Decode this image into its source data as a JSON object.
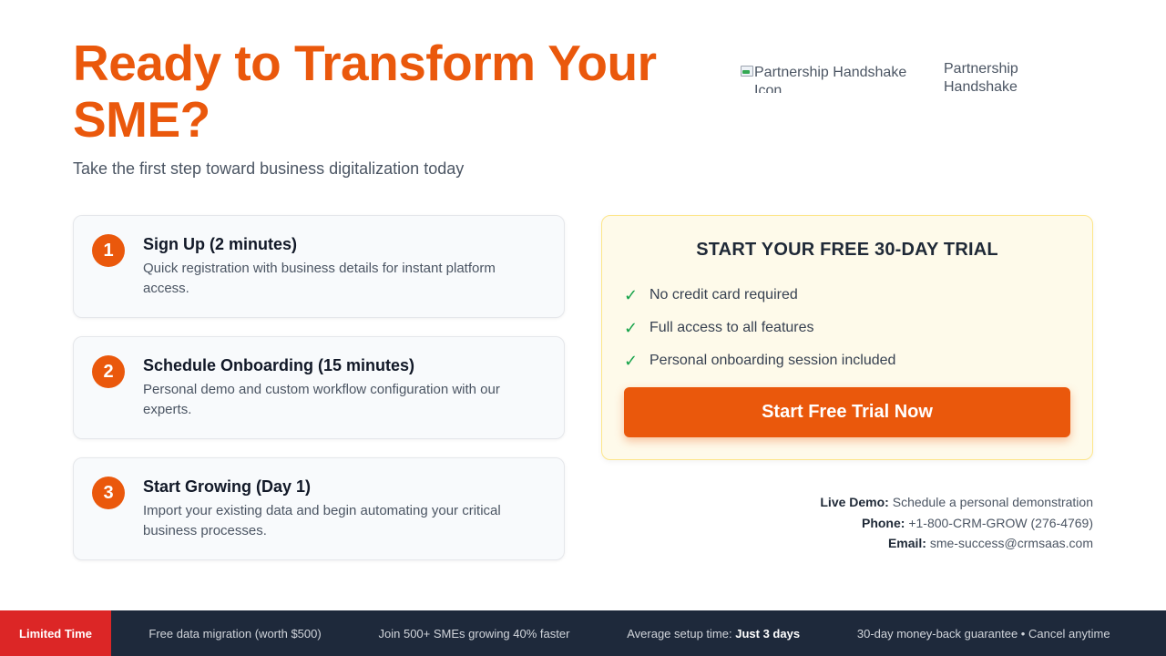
{
  "header": {
    "title": "Ready to Transform Your SME?",
    "subtitle": "Take the first step toward business digitalization today"
  },
  "hero_image": {
    "alt": "Partnership Handshake Icon",
    "caption": "Partnership Handshake"
  },
  "steps": [
    {
      "number": "1",
      "title": "Sign Up (2 minutes)",
      "description": "Quick registration with business details for instant platform access."
    },
    {
      "number": "2",
      "title": "Schedule Onboarding (15 minutes)",
      "description": "Personal demo and custom workflow configuration with our experts."
    },
    {
      "number": "3",
      "title": "Start Growing (Day 1)",
      "description": "Import your existing data and begin automating your critical business processes."
    }
  ],
  "trial": {
    "title": "START YOUR FREE 30-DAY TRIAL",
    "benefits": [
      "No credit card required",
      "Full access to all features",
      "Personal onboarding session included"
    ],
    "check_icon": "✓",
    "cta_label": "Start Free Trial Now"
  },
  "contact": {
    "demo_label": "Live Demo:",
    "demo_value": "Schedule a personal demonstration",
    "phone_label": "Phone:",
    "phone_value": "+1-800-CRM-GROW (276-4769)",
    "email_label": "Email:",
    "email_value": "sme-success@crmsaas.com"
  },
  "bottom_bar": {
    "badge": "Limited Time",
    "items": [
      "Free data migration (worth $500)",
      "Join 500+ SMEs growing 40% faster",
      "30-day money-back guarantee • Cancel anytime"
    ],
    "setup_label": "Average setup time:",
    "setup_value": "Just 3 days"
  },
  "colors": {
    "accent": "#ea580c",
    "check": "#16a34a",
    "bar_bg": "#1e293b",
    "badge_bg": "#dc2626",
    "trial_bg": "#fefaea"
  }
}
